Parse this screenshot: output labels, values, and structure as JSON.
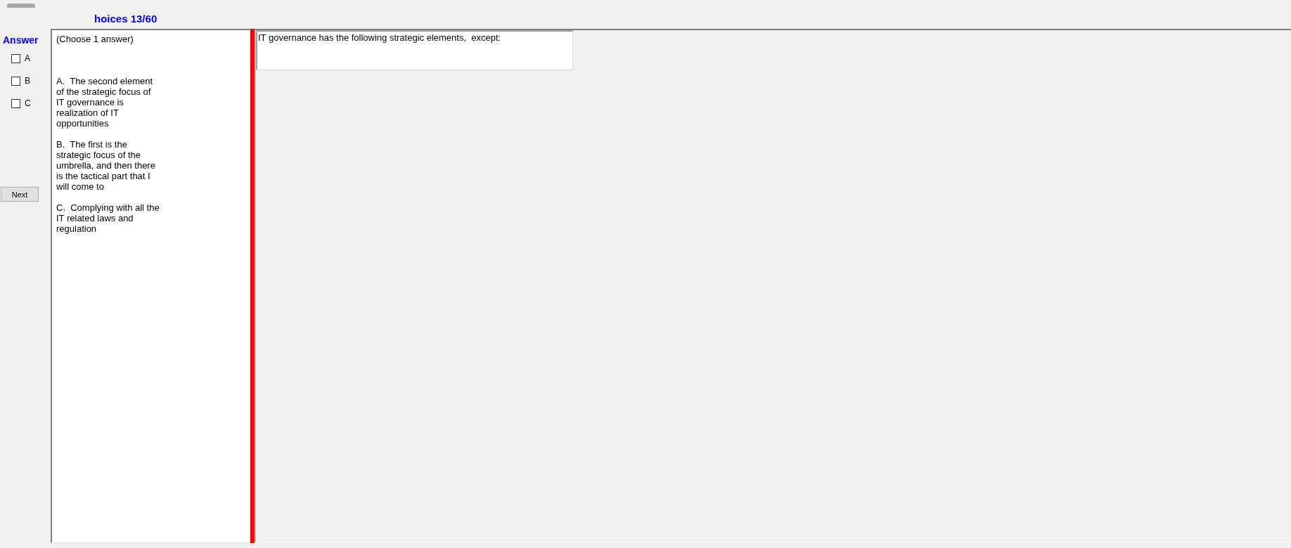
{
  "header": {
    "title": "hoices 13/60"
  },
  "answer": {
    "label": "Answer",
    "options": [
      {
        "label": "A",
        "checked": false
      },
      {
        "label": "B",
        "checked": false
      },
      {
        "label": "C",
        "checked": false
      }
    ],
    "next_button": "Next"
  },
  "choices_panel": {
    "instruction": "(Choose 1 answer)",
    "choices": [
      "A.  The second element of the strategic focus of IT governance is realization of IT opportunities",
      "B.  The first is the strategic focus of the umbrella, and then there is the tactical part that I will come to",
      "C.  Complying with all the IT related laws and regulation"
    ]
  },
  "question_panel": {
    "question": "IT governance has the following strategic elements,  except:"
  }
}
